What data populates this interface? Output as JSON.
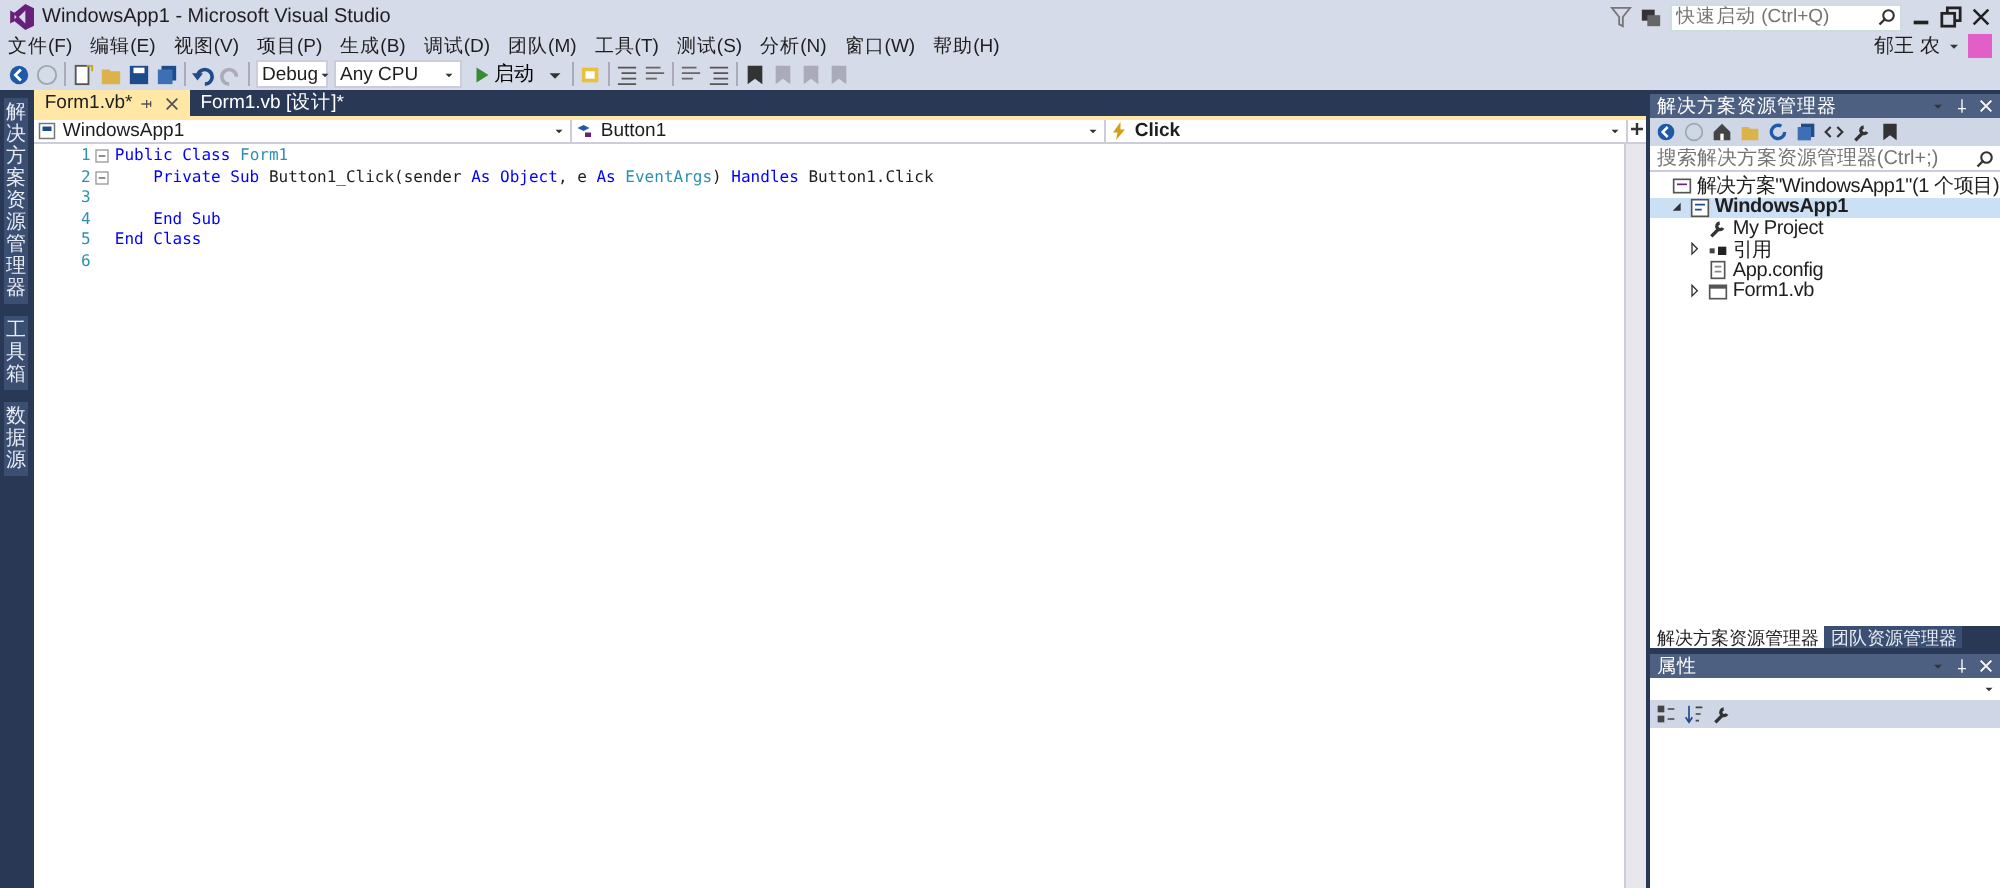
{
  "window": {
    "title": "WindowsApp1 - Microsoft Visual Studio"
  },
  "quick_launch": {
    "placeholder": "快速启动 (Ctrl+Q)"
  },
  "user": {
    "name": "郁王 农"
  },
  "menu": [
    "文件(F)",
    "编辑(E)",
    "视图(V)",
    "项目(P)",
    "生成(B)",
    "调试(D)",
    "团队(M)",
    "工具(T)",
    "测试(S)",
    "分析(N)",
    "窗口(W)",
    "帮助(H)"
  ],
  "toolbar": {
    "configuration": "Debug",
    "platform": "Any CPU",
    "start": "启动"
  },
  "side_tabs": [
    "解决方案资源管理器",
    "工具箱",
    "数据源"
  ],
  "editor_tabs": [
    {
      "label": "Form1.vb*",
      "selected": true
    },
    {
      "label": "Form1.vb [设计]*",
      "selected": false
    }
  ],
  "navigation": {
    "project": "WindowsApp1",
    "object": "Button1",
    "event": "Click"
  },
  "code": [
    {
      "number": "1",
      "foldable": true,
      "segments": [
        {
          "text": "Public Class ",
          "kind": "keyword"
        },
        {
          "text": "Form1",
          "kind": "type"
        }
      ]
    },
    {
      "number": "2",
      "foldable": true,
      "segments": [
        {
          "text": "    Private Sub ",
          "kind": "keyword"
        },
        {
          "text": "Button1_Click(sender ",
          "kind": "plain"
        },
        {
          "text": "As Object",
          "kind": "keyword"
        },
        {
          "text": ", e ",
          "kind": "plain"
        },
        {
          "text": "As ",
          "kind": "keyword"
        },
        {
          "text": "EventArgs",
          "kind": "type"
        },
        {
          "text": ") ",
          "kind": "plain"
        },
        {
          "text": "Handles ",
          "kind": "keyword"
        },
        {
          "text": "Button1.Click",
          "kind": "plain"
        }
      ]
    },
    {
      "number": "3",
      "foldable": false
    },
    {
      "number": "4",
      "foldable": false,
      "segments": [
        {
          "text": "    End Sub",
          "kind": "keyword"
        }
      ]
    },
    {
      "number": "5",
      "foldable": false,
      "segments": [
        {
          "text": "End Class",
          "kind": "keyword"
        }
      ]
    },
    {
      "number": "6",
      "foldable": false
    }
  ],
  "solution_explorer": {
    "title": "解决方案资源管理器",
    "search": {
      "placeholder": "搜索解决方案资源管理器(Ctrl+;)"
    },
    "tree": [
      {
        "label": "解决方案\"WindowsApp1\"(1 个项目)",
        "selected": false,
        "children": [
          {
            "label": "WindowsApp1",
            "selected": true,
            "expanded": true,
            "children": [
              {
                "label": "My Project",
                "selected": false
              },
              {
                "label": "引用",
                "selected": false,
                "expanded": false
              },
              {
                "label": "App.config",
                "selected": false
              },
              {
                "label": "Form1.vb",
                "selected": false,
                "expanded": false
              }
            ]
          }
        ]
      }
    ],
    "bottom_tabs": [
      {
        "label": "解决方案资源管理器",
        "selected": true
      },
      {
        "label": "团队资源管理器",
        "selected": false
      }
    ]
  },
  "properties": {
    "title": "属性"
  }
}
